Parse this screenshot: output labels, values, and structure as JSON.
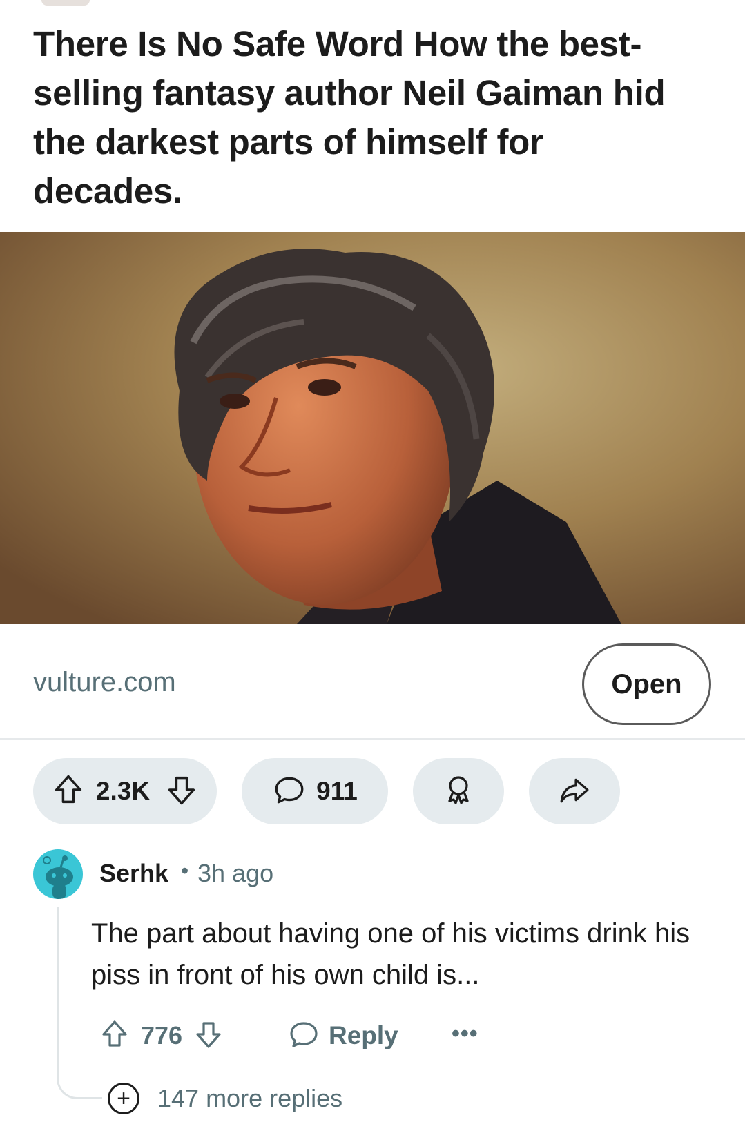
{
  "post": {
    "title": "There Is No Safe Word How the best-selling fantasy author Neil Gaiman hid the darkest parts of himself for decades.",
    "link_domain": "vulture.com",
    "open_label": "Open",
    "score": "2.3K",
    "comment_count": "911"
  },
  "comment": {
    "author": "Serhk",
    "separator": "•",
    "time": "3h ago",
    "body": "The part about having one of his victims drink his piss in front of his own child is...",
    "score": "776",
    "reply_label": "Reply",
    "more_label": "•••",
    "more_replies_label": "147 more replies",
    "plus_symbol": "+"
  },
  "icons": {
    "upvote": "upvote-arrow-icon",
    "downvote": "downvote-arrow-icon",
    "comment": "comment-bubble-icon",
    "award": "award-ribbon-icon",
    "share": "share-arrow-icon",
    "avatar": "snoo-avatar-icon"
  },
  "colors": {
    "pill_bg": "#e5ebee",
    "secondary_text": "#576f76",
    "avatar_bg": "#3ac6d6"
  }
}
